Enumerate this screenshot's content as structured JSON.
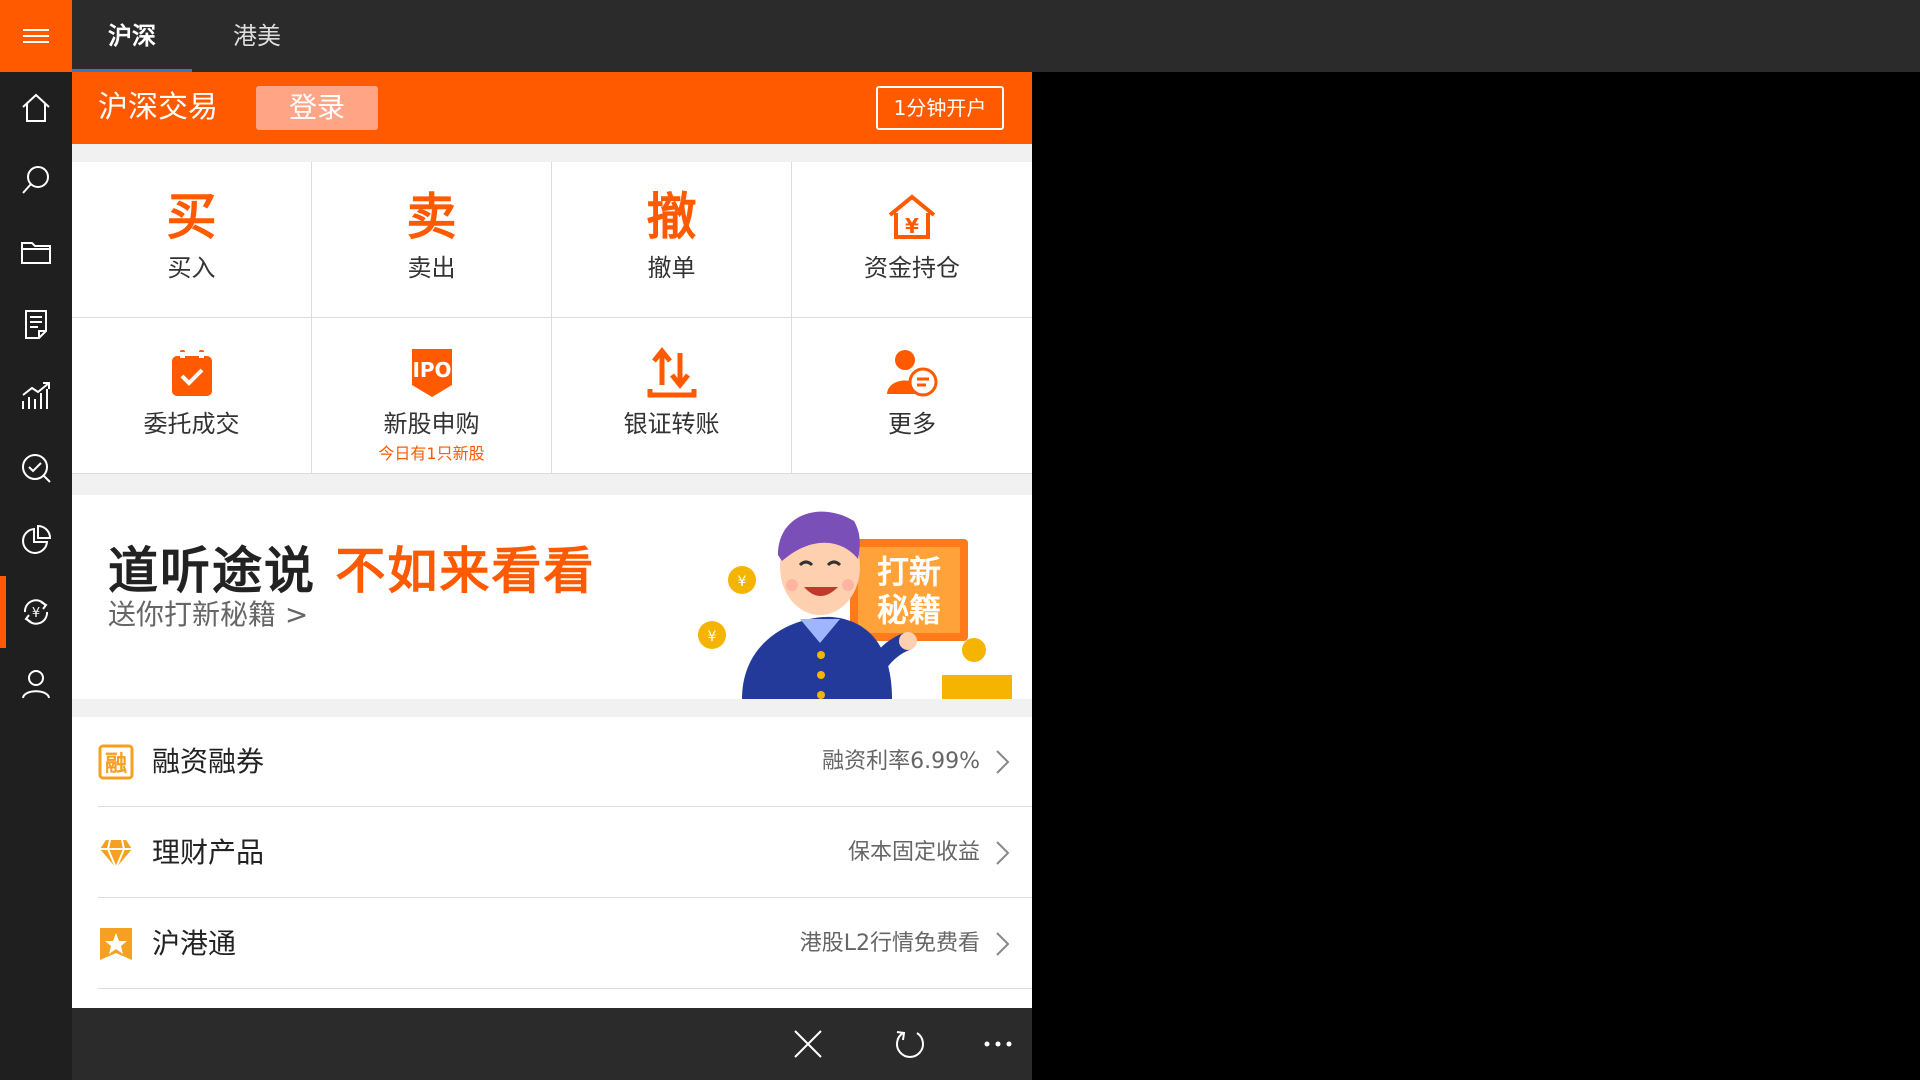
{
  "tabs": [
    {
      "label": "沪深",
      "active": true
    },
    {
      "label": "港美",
      "active": false
    }
  ],
  "rail": [
    {
      "icon": "home-icon"
    },
    {
      "icon": "search-icon"
    },
    {
      "icon": "folder-icon"
    },
    {
      "icon": "document-icon"
    },
    {
      "icon": "chart-icon"
    },
    {
      "icon": "check-search-icon"
    },
    {
      "icon": "pie-chart-icon"
    },
    {
      "icon": "yuan-exchange-icon",
      "active": true
    },
    {
      "icon": "user-icon"
    }
  ],
  "header": {
    "title": "沪深交易",
    "login_label": "登录",
    "open_account_label": "1分钟开户"
  },
  "grid": [
    {
      "label": "买入",
      "char": "买"
    },
    {
      "label": "卖出",
      "char": "卖"
    },
    {
      "label": "撤单",
      "char": "撤"
    },
    {
      "label": "资金持仓",
      "icon": "house-yuan-icon"
    },
    {
      "label": "委托成交",
      "icon": "calendar-check-icon"
    },
    {
      "label": "新股申购",
      "icon": "ipo-icon",
      "badge": "IPO",
      "sub": "今日有1只新股"
    },
    {
      "label": "银证转账",
      "icon": "transfer-arrows-icon"
    },
    {
      "label": "更多",
      "icon": "user-chat-icon"
    }
  ],
  "banner": {
    "headline_a": "道听途说",
    "headline_b": "不如来看看",
    "subline": "送你打新秘籍 >",
    "sign_text": "打新秘籍"
  },
  "list": [
    {
      "label": "融资融券",
      "value": "融资利率6.99%",
      "icon": "rong-icon"
    },
    {
      "label": "理财产品",
      "value": "保本固定收益",
      "icon": "diamond-icon"
    },
    {
      "label": "沪港通",
      "value": "港股L2行情免费看",
      "icon": "bauhinia-icon"
    }
  ],
  "colors": {
    "accent": "#ff5a00",
    "rail": "#1f1f1f",
    "topbar": "#2b2b2b",
    "tab_indicator": "#3a74c7"
  }
}
